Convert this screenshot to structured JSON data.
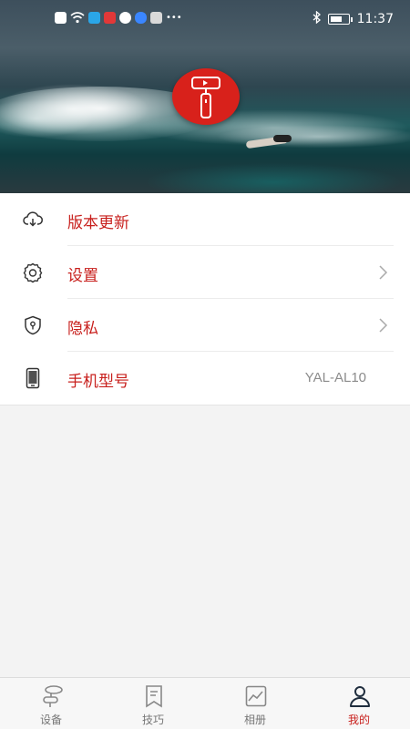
{
  "status_bar": {
    "time": "11:37",
    "icons": [
      "alert-icon",
      "wifi-icon",
      "search-app-icon",
      "red-app-icon",
      "sync-icon",
      "cloud-icon",
      "mail-icon",
      "more-dots-icon",
      "bluetooth-icon",
      "battery-icon"
    ]
  },
  "header": {
    "logo_icon": "gimbal-logo-icon",
    "brand_color": "#d8211b"
  },
  "menu": {
    "items": [
      {
        "label": "版本更新",
        "icon": "download-cloud-icon",
        "has_arrow": false
      },
      {
        "label": "设置",
        "icon": "gear-icon",
        "has_arrow": true
      },
      {
        "label": "隐私",
        "icon": "shield-lock-icon",
        "has_arrow": true
      },
      {
        "label": "手机型号",
        "icon": "phone-icon",
        "value": "YAL-AL10",
        "has_arrow": false
      }
    ]
  },
  "bottom_nav": {
    "tabs": [
      {
        "label": "设备",
        "icon": "gimbal-device-icon",
        "active": false
      },
      {
        "label": "技巧",
        "icon": "bookmark-tips-icon",
        "active": false
      },
      {
        "label": "相册",
        "icon": "gallery-icon",
        "active": false
      },
      {
        "label": "我的",
        "icon": "person-icon",
        "active": true
      }
    ],
    "active_color": "#c8201d"
  }
}
